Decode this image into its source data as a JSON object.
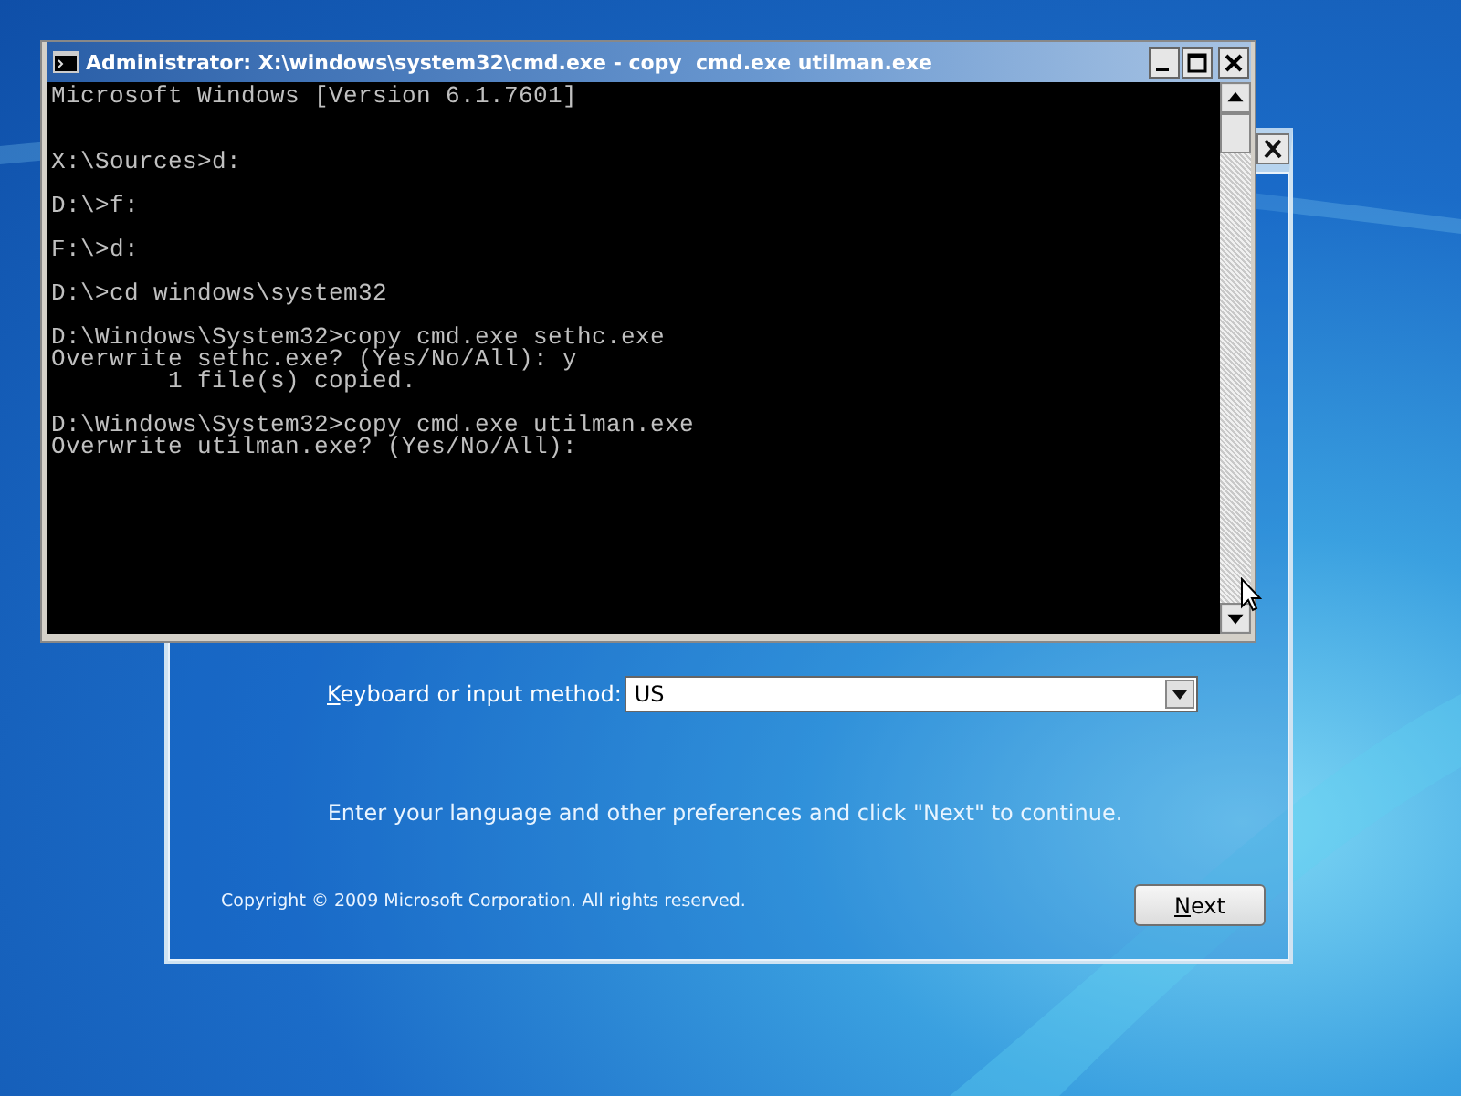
{
  "cmd_window": {
    "title": "Administrator: X:\\windows\\system32\\cmd.exe - copy  cmd.exe utilman.exe",
    "console_blocks": [
      [
        "Microsoft Windows [Version 6.1.7601]"
      ],
      [
        "X:\\Sources>d:"
      ],
      [
        "D:\\>f:"
      ],
      [
        "F:\\>d:"
      ],
      [
        "D:\\>cd windows\\system32"
      ],
      [
        "D:\\Windows\\System32>copy cmd.exe sethc.exe",
        "Overwrite sethc.exe? (Yes/No/All): y",
        "        1 file(s) copied."
      ],
      [
        "D:\\Windows\\System32>copy cmd.exe utilman.exe",
        "Overwrite utilman.exe? (Yes/No/All):"
      ]
    ]
  },
  "setup_window": {
    "keyboard_label": "Keyboard or input method:",
    "keyboard_value": "US",
    "instruction": "Enter your language and other preferences and click \"Next\" to continue.",
    "copyright": "Copyright © 2009 Microsoft Corporation. All rights reserved.",
    "next_button": "Next"
  }
}
